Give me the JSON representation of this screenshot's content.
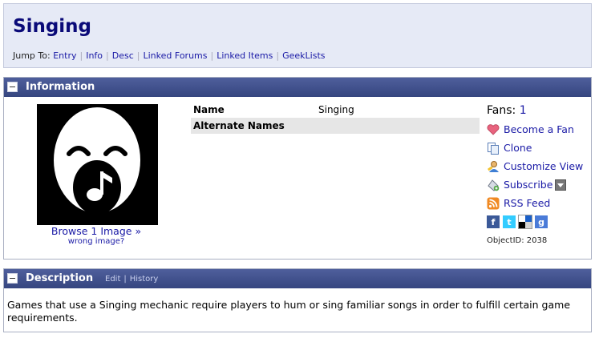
{
  "header": {
    "title": "Singing",
    "jump_label": "Jump To:",
    "jump_links": [
      "Entry",
      "Info",
      "Desc",
      "Linked Forums",
      "Linked Items",
      "GeekLists"
    ]
  },
  "info_panel": {
    "title": "Information",
    "image": {
      "browse": "Browse 1 Image »",
      "wrong": "wrong image?"
    },
    "attributes": [
      {
        "key": "Name",
        "value": "Singing"
      },
      {
        "key": "Alternate Names",
        "value": ""
      }
    ],
    "side": {
      "fans_label": "Fans:",
      "fans_count": "1",
      "actions": [
        {
          "label": "Become a Fan",
          "icon": "heart-icon"
        },
        {
          "label": "Clone",
          "icon": "clone-icon"
        },
        {
          "label": "Customize View",
          "icon": "customize-icon"
        },
        {
          "label": "Subscribe",
          "icon": "subscribe-icon"
        },
        {
          "label": "RSS Feed",
          "icon": "rss-icon"
        }
      ],
      "social": [
        {
          "icon": "facebook-icon",
          "glyph": "f",
          "color": "#3b5998"
        },
        {
          "icon": "twitter-icon",
          "glyph": "t",
          "color": "#33ccff"
        },
        {
          "icon": "delicious-icon",
          "glyph": "",
          "color": "#000000"
        },
        {
          "icon": "google-icon",
          "glyph": "g",
          "color": "#4a7bd8"
        }
      ],
      "object_id": "ObjectID: 2038"
    }
  },
  "desc_panel": {
    "title": "Description",
    "links": [
      "Edit",
      "History"
    ],
    "text": "Games that use a Singing mechanic require players to hum or sing familiar songs in order to fulfill certain game requirements."
  },
  "colors": {
    "header_bg": "#e6eaf6",
    "panel_head": "#3f4f8c",
    "link": "#1a1aa6",
    "title": "#0a0a78"
  }
}
